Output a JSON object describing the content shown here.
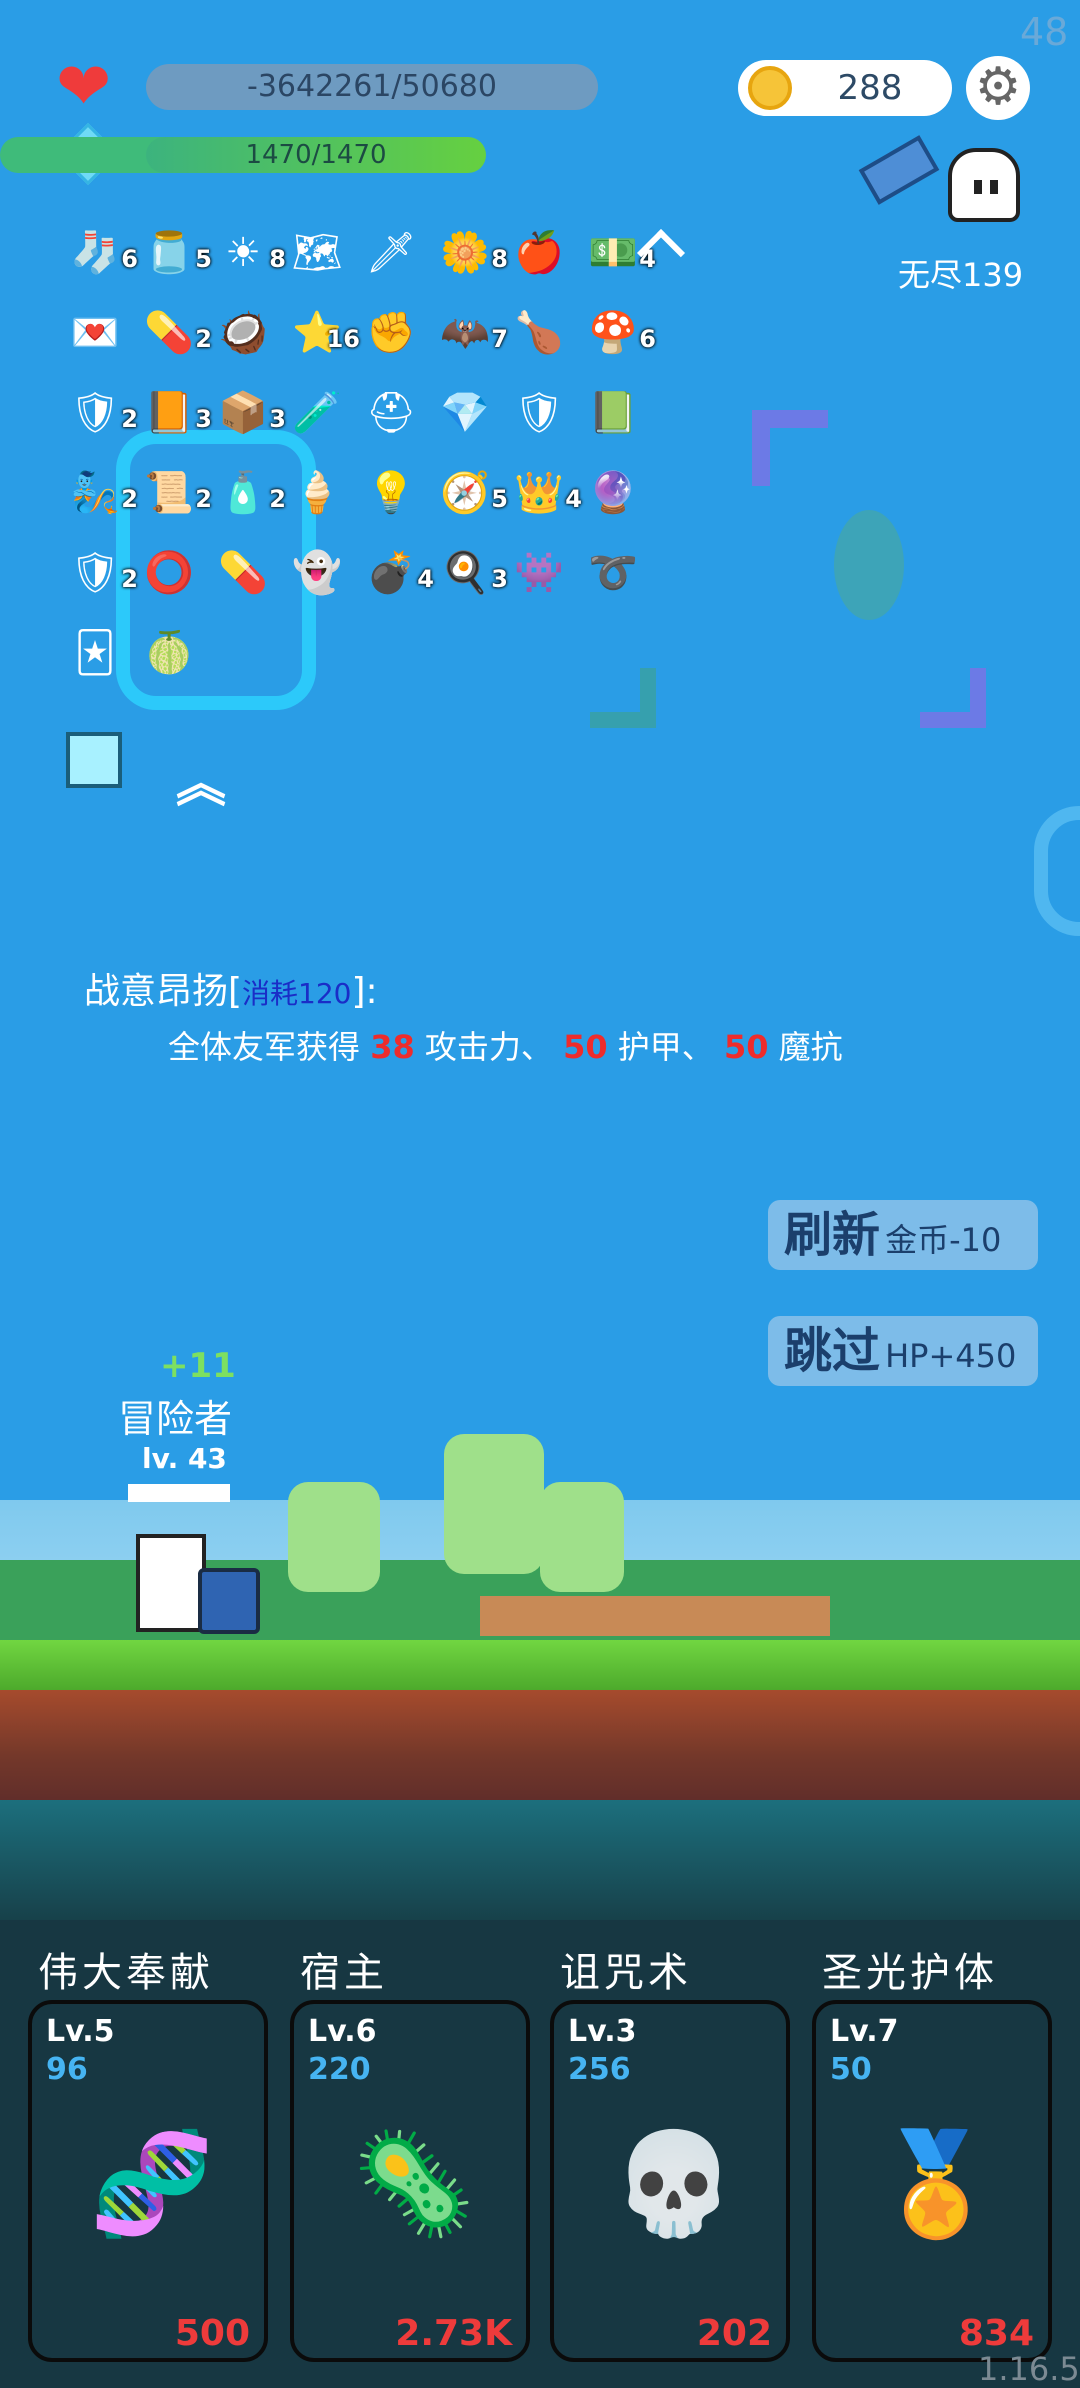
{
  "fps": "48",
  "hud": {
    "hp_text": "-3642261/50680",
    "mp_text": "1470/1470",
    "mp_fraction": 1.0,
    "coins": "288",
    "mode": "无尽139"
  },
  "inventory": [
    [
      {
        "icon": "sock-icon",
        "glyph": "🧦",
        "count": "6"
      },
      {
        "icon": "jam-jar-icon",
        "glyph": "🫙",
        "count": "5"
      },
      {
        "icon": "sun-icon",
        "glyph": "☀",
        "count": "8"
      },
      {
        "icon": "map-icon",
        "glyph": "🗺",
        "count": ""
      },
      {
        "icon": "sword-icon",
        "glyph": "🗡",
        "count": ""
      },
      {
        "icon": "flower-icon",
        "glyph": "🌼",
        "count": "8"
      },
      {
        "icon": "apple-icon",
        "glyph": "🍎",
        "count": ""
      },
      {
        "icon": "money-heart-icon",
        "glyph": "💵",
        "count": "4"
      }
    ],
    [
      {
        "icon": "heart-card-icon",
        "glyph": "💌",
        "count": ""
      },
      {
        "icon": "pill-icon",
        "glyph": "💊",
        "count": "2"
      },
      {
        "icon": "coconut-icon",
        "glyph": "🥥",
        "count": ""
      },
      {
        "icon": "star-card-icon",
        "glyph": "⭐",
        "count": "16"
      },
      {
        "icon": "fist-icon",
        "glyph": "✊",
        "count": ""
      },
      {
        "icon": "bat-icon",
        "glyph": "🦇",
        "count": "7"
      },
      {
        "icon": "drumstick-icon",
        "glyph": "🍗",
        "count": ""
      },
      {
        "icon": "mushroom-icon",
        "glyph": "🍄",
        "count": "6"
      }
    ],
    [
      {
        "icon": "round-shield-icon",
        "glyph": "🛡",
        "count": "2"
      },
      {
        "icon": "book-icon",
        "glyph": "📙",
        "count": "3"
      },
      {
        "icon": "chest-icon",
        "glyph": "📦",
        "count": "3"
      },
      {
        "icon": "potion-icon",
        "glyph": "🧪",
        "count": ""
      },
      {
        "icon": "helmet-icon",
        "glyph": "⛑",
        "count": ""
      },
      {
        "icon": "gem-icon",
        "glyph": "💎",
        "count": ""
      },
      {
        "icon": "shield-icon",
        "glyph": "🛡",
        "count": ""
      },
      {
        "icon": "note-icon",
        "glyph": "📗",
        "count": ""
      }
    ],
    [
      {
        "icon": "lamp-icon",
        "glyph": "🧞",
        "count": "2"
      },
      {
        "icon": "scroll-icon",
        "glyph": "📜",
        "count": "2"
      },
      {
        "icon": "bottle-icon",
        "glyph": "🧴",
        "count": "2"
      },
      {
        "icon": "ice-cream-icon",
        "glyph": "🍦",
        "count": ""
      },
      {
        "icon": "bulb-icon",
        "glyph": "💡",
        "count": ""
      },
      {
        "icon": "compass-icon",
        "glyph": "🧭",
        "count": "5"
      },
      {
        "icon": "crown-icon",
        "glyph": "👑",
        "count": "4"
      },
      {
        "icon": "crystal-ball-icon",
        "glyph": "🔮",
        "count": ""
      }
    ],
    [
      {
        "icon": "star-shield-icon",
        "glyph": "🛡",
        "count": "2"
      },
      {
        "icon": "donut-shield-icon",
        "glyph": "⭕",
        "count": ""
      },
      {
        "icon": "capsule-icon",
        "glyph": "💊",
        "count": ""
      },
      {
        "icon": "ghost-icon",
        "glyph": "👻",
        "count": ""
      },
      {
        "icon": "grenade-icon",
        "glyph": "💣",
        "count": "4"
      },
      {
        "icon": "egg-icon",
        "glyph": "🍳",
        "count": "3"
      },
      {
        "icon": "monster-icon",
        "glyph": "👾",
        "count": ""
      },
      {
        "icon": "noose-icon",
        "glyph": "➰",
        "count": ""
      }
    ],
    [
      {
        "icon": "cards-icon",
        "glyph": "🃏",
        "count": ""
      },
      {
        "icon": "lime-icon",
        "glyph": "🍈",
        "count": ""
      }
    ]
  ],
  "skill": {
    "name": "战意昂扬[",
    "cost": "消耗120",
    "name_end": "]:",
    "desc_a": "全体友军获得 ",
    "attack": "38",
    "desc_b": " 攻击力、 ",
    "armor": "50",
    "desc_c": " 护甲、 ",
    "resist": "50",
    "desc_d": " 魔抗"
  },
  "buttons": {
    "refresh_big": "刷新",
    "refresh_small": "金币-10",
    "skip_big": "跳过",
    "skip_small": "HP+450"
  },
  "hero": {
    "gain": "+11",
    "name": "冒险者",
    "level": "lv. 43"
  },
  "cards": [
    {
      "title": "伟大奉献",
      "lv": "Lv.5",
      "cost": "96",
      "value": "500",
      "icon": "dna-icon",
      "glyph": "🧬"
    },
    {
      "title": "宿主",
      "lv": "Lv.6",
      "cost": "220",
      "value": "2.73K",
      "icon": "virus-monster-icon",
      "glyph": "🦠"
    },
    {
      "title": "诅咒术",
      "lv": "Lv.3",
      "cost": "256",
      "value": "202",
      "icon": "skull-icon",
      "glyph": "💀"
    },
    {
      "title": "圣光护体",
      "lv": "Lv.7",
      "cost": "50",
      "value": "834",
      "icon": "gold-medal-icon",
      "glyph": "🏅"
    }
  ],
  "version": "1.16.5",
  "colors": {
    "sky": "#2a9de6",
    "hp_bar": "#6e9bc1",
    "mp_bar": "#4fc562",
    "danger": "#ee2c2c",
    "card_bg": "#173742",
    "cost_blue": "#46b4f2"
  }
}
